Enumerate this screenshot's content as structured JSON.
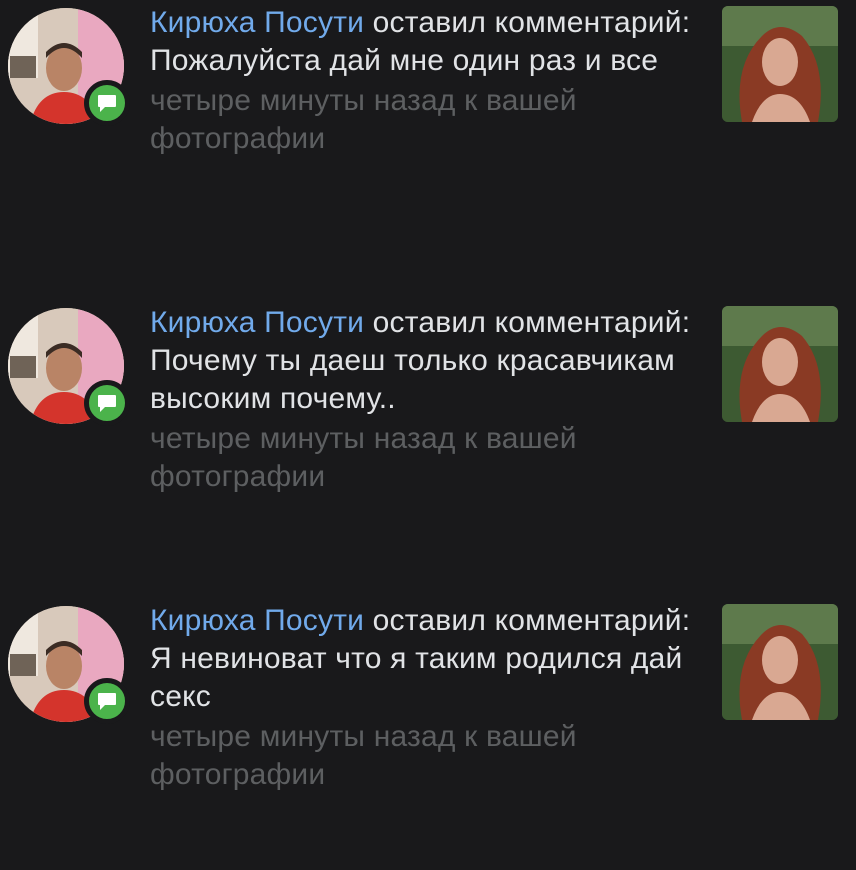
{
  "notifications": [
    {
      "author": "Кирюха Посути",
      "action": "оставил комментарий:",
      "comment": "Пожалуйста дай мне один раз и все",
      "meta": "четыре минуты назад к вашей фотографии",
      "badge_icon": "comment-icon"
    },
    {
      "author": "Кирюха Посути",
      "action": "оставил комментарий:",
      "comment": "Почему ты даеш только красавчикам высоким почему..",
      "meta": "четыре минуты назад к вашей фотографии",
      "badge_icon": "comment-icon"
    },
    {
      "author": "Кирюха Посути",
      "action": "оставил комментарий:",
      "comment": "Я невиноват что я таким родился дай секс",
      "meta": "четыре минуты назад к вашей фотографии",
      "badge_icon": "comment-icon"
    }
  ],
  "colors": {
    "background": "#19191b",
    "link": "#71aaeb",
    "text": "#e1e3e6",
    "secondary": "#5d5f61",
    "badge": "#4bb34b"
  }
}
